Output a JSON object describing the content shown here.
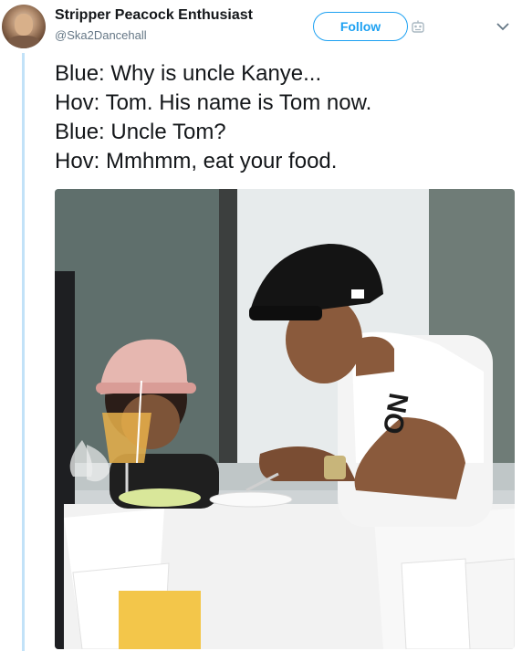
{
  "user": {
    "display_name": "Stripper Peacock Enthusiast",
    "handle": "@Ska2Dancehall"
  },
  "actions": {
    "follow_label": "Follow"
  },
  "tweet": {
    "lines": [
      "Blue: Why is uncle Kanye...",
      "Hov: Tom. His name is Tom now.",
      "Blue: Uncle Tom?",
      "Hov: Mmhmm, eat your food."
    ]
  },
  "icons": {
    "bot": "robot-icon",
    "menu": "chevron-down-icon"
  },
  "colors": {
    "accent": "#1da1f2",
    "thread_line": "#c2e2f8",
    "text": "#14171a",
    "muted": "#657786"
  }
}
